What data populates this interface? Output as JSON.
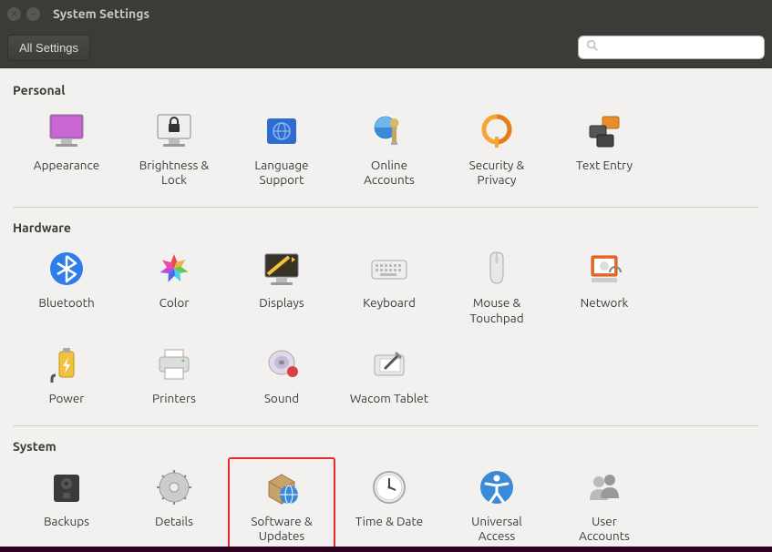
{
  "window": {
    "title": "System Settings"
  },
  "toolbar": {
    "all_settings_label": "All Settings",
    "search_placeholder": ""
  },
  "sections": {
    "personal": {
      "title": "Personal",
      "items": [
        {
          "id": "appearance",
          "label": "Appearance"
        },
        {
          "id": "brightness",
          "label": "Brightness &\nLock"
        },
        {
          "id": "language",
          "label": "Language\nSupport"
        },
        {
          "id": "online-accounts",
          "label": "Online\nAccounts"
        },
        {
          "id": "security",
          "label": "Security &\nPrivacy"
        },
        {
          "id": "text-entry",
          "label": "Text Entry"
        }
      ]
    },
    "hardware": {
      "title": "Hardware",
      "items": [
        {
          "id": "bluetooth",
          "label": "Bluetooth"
        },
        {
          "id": "color",
          "label": "Color"
        },
        {
          "id": "displays",
          "label": "Displays"
        },
        {
          "id": "keyboard",
          "label": "Keyboard"
        },
        {
          "id": "mouse",
          "label": "Mouse &\nTouchpad"
        },
        {
          "id": "network",
          "label": "Network"
        },
        {
          "id": "power",
          "label": "Power"
        },
        {
          "id": "printers",
          "label": "Printers"
        },
        {
          "id": "sound",
          "label": "Sound"
        },
        {
          "id": "wacom",
          "label": "Wacom Tablet"
        }
      ]
    },
    "system": {
      "title": "System",
      "items": [
        {
          "id": "backups",
          "label": "Backups"
        },
        {
          "id": "details",
          "label": "Details"
        },
        {
          "id": "software",
          "label": "Software &\nUpdates",
          "highlighted": true
        },
        {
          "id": "time-date",
          "label": "Time & Date"
        },
        {
          "id": "universal",
          "label": "Universal\nAccess"
        },
        {
          "id": "user-accounts",
          "label": "User\nAccounts"
        }
      ]
    }
  }
}
